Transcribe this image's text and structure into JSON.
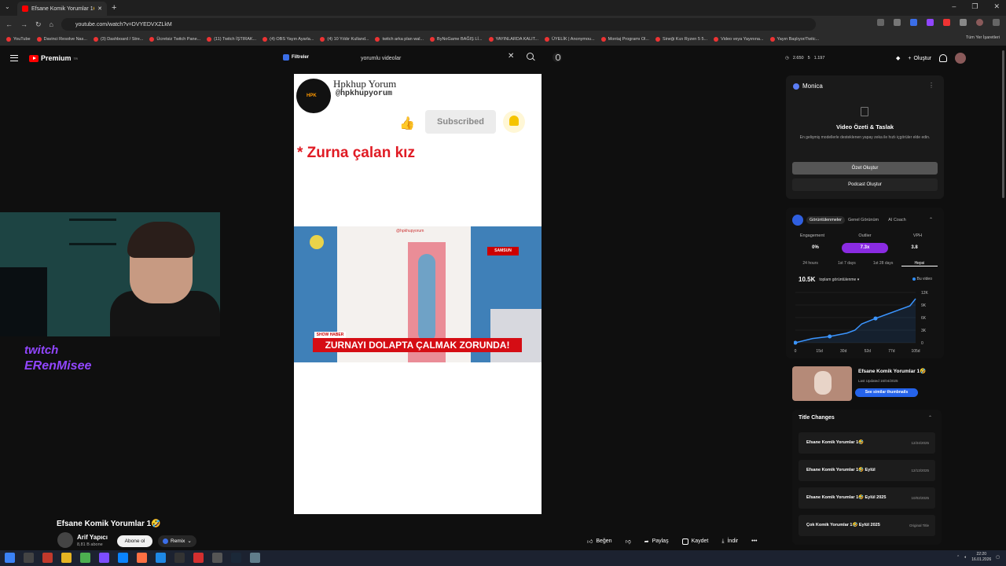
{
  "browser": {
    "tab_title": "Efsane Komik Yorumlar 1🤣",
    "url": "youtube.com/watch?v=DVYEDVXZLkM",
    "bookmarks": [
      "YouTube",
      "Davinci Resolve Nas...",
      "(3) Dashboard / Stre...",
      "Ücretsiz Twitch Pane...",
      "(11) Twitch İŞTIRAK...",
      "(4) OBS Yayın Ayarla...",
      "(4) 10 Yıldır Kulland...",
      "twitch arka plan wal...",
      "ByNoGame BAĞIŞ Lİ...",
      "YAYINLARDA KALIT...",
      "ÜYELİK | Anonymou...",
      "Montaj Programı Ol...",
      "Sineği Kızı Ryzen 5 5...",
      "Video veya Yayınına...",
      "Yayın Başlıyor/Twitc..."
    ],
    "bookmarks_all": "Tüm Yer İşaretleri"
  },
  "yt_header": {
    "logo_text": "Premium",
    "logo_sup": "TR",
    "filters_label": "Filtreler",
    "search_value": "yorumlu videolar",
    "stats": [
      "2.650",
      "5",
      "1.197"
    ],
    "create_label": "Oluştur"
  },
  "video": {
    "channel_name": "Hpkhup Yorum",
    "channel_handle": "@hpkhupyorum",
    "subscribed_label": "Subscribed",
    "comment_text": "* Zurna çalan kız",
    "watermark": "@hpkhupyorum",
    "city_tag": "SAMSUN",
    "banner_label": "SHOW HABER",
    "banner_text": "ZURNAYI DOLAPTA ÇALMAK ZORUNDA!"
  },
  "stream_overlay": {
    "twitch_logo": "twitch",
    "twitch_user": "ERenMisee"
  },
  "monica": {
    "title": "Monica",
    "heading": "Video Özeti & Taslak",
    "description": "En gelişmiş modellerle desteklenen yapay zeka ile hızlı içgörüler elde edin.",
    "summary_button": "Özet Oluştur",
    "podcast_button": "Podcast Oluştur"
  },
  "analytics": {
    "tabs": [
      "Görüntülenmeler",
      "Genel Görünüm",
      "AI Coach"
    ],
    "metric_labels": [
      "Engagement",
      "Outlier",
      "VPH"
    ],
    "metric_values": [
      "0%",
      "7.3x",
      "3.8"
    ],
    "ranges": [
      "24 hours",
      "1st 7 days",
      "1st 28 days",
      "Hepsi"
    ],
    "views_total": "10.5K",
    "views_label": "toplam görüntülenme",
    "legend": "Bu video"
  },
  "chart_data": {
    "type": "line",
    "x": [
      "0",
      "15d",
      "30d",
      "52d",
      "77d",
      "105d"
    ],
    "y_ticks": [
      "0",
      "3K",
      "6K",
      "9K",
      "12K"
    ],
    "series": [
      {
        "name": "Bu video",
        "points": [
          [
            0,
            0
          ],
          [
            15,
            1000
          ],
          [
            30,
            1500
          ],
          [
            45,
            2300
          ],
          [
            52,
            3000
          ],
          [
            58,
            4500
          ],
          [
            70,
            5800
          ],
          [
            80,
            6800
          ],
          [
            90,
            7800
          ],
          [
            100,
            8800
          ],
          [
            105,
            10500
          ]
        ]
      }
    ],
    "ylim": [
      0,
      12000
    ],
    "xlim": [
      0,
      105
    ]
  },
  "related": {
    "title": "Efsane Komik Yorumlar 1🤣",
    "date": "Last Updated 16/04/2025",
    "button": "See similar thumbnails"
  },
  "title_changes": {
    "heading": "Title Changes",
    "items": [
      {
        "name": "Efsane Komik Yorumlar 1🤣",
        "date": "12/24/2025"
      },
      {
        "name": "Efsane Komik Yorumlar 1🤣 Eylül",
        "date": "12/13/2025"
      },
      {
        "name": "Efsane Komik Yorumlar 1🤣 Eylül 2025",
        "date": "10/02/2025"
      },
      {
        "name": "Çok Komik Yorumlar 1🤣 Eylül 2025",
        "date": "Original Title"
      }
    ]
  },
  "below_video": {
    "title": "Efsane Komik Yorumlar 1🤣",
    "channel": "Arif Yapıcı",
    "subs": "8,81 B abone",
    "subscribe": "Abone ol",
    "remix": "Remix",
    "actions": [
      "Beğen",
      "",
      "Paylaş",
      "Kaydet",
      "İndir",
      "•••"
    ]
  },
  "taskbar": {
    "time": "22:20",
    "date": "16.01.2026"
  }
}
